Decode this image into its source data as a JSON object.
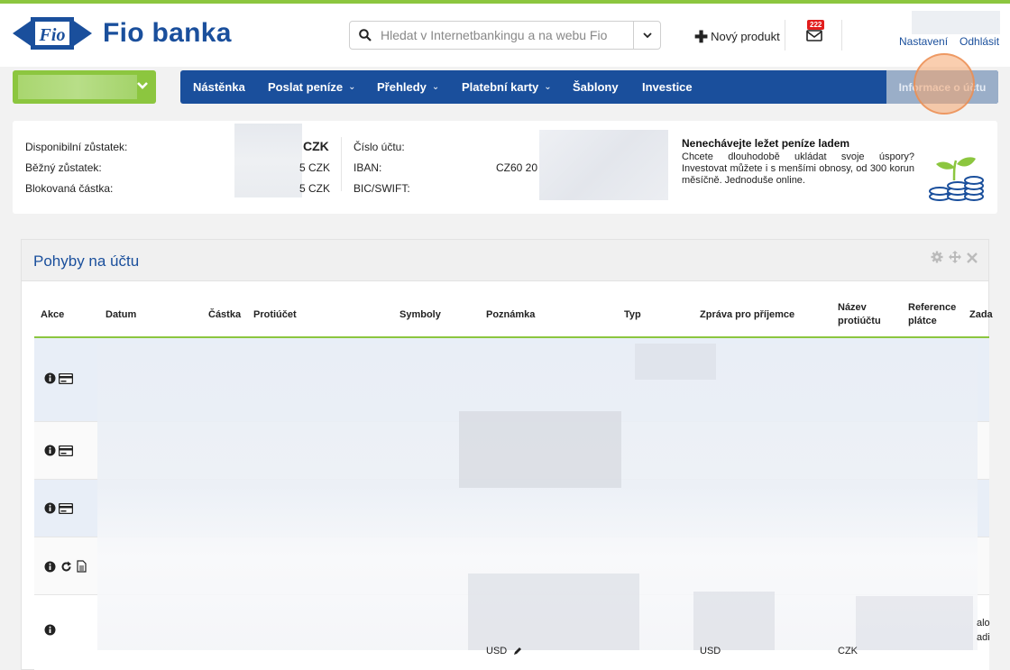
{
  "brand": {
    "name": "Fio banka",
    "logo_mark": "Fio",
    "accent_green": "#8cc63f",
    "brand_blue": "#1a4f9c"
  },
  "header": {
    "search_placeholder": "Hledat v Internetbankingu a na webu Fio",
    "new_product_label": "Nový produkt",
    "messages_count": "222",
    "settings_link": "Nastavení",
    "logout_link": "Odhlásit"
  },
  "nav": {
    "items": [
      {
        "label": "Nástěnka",
        "dropdown": ""
      },
      {
        "label": "Poslat peníze",
        "dropdown": "⌄"
      },
      {
        "label": "Přehledy",
        "dropdown": "⌄"
      },
      {
        "label": "Platební karty",
        "dropdown": "⌄"
      },
      {
        "label": "Šablony",
        "dropdown": ""
      },
      {
        "label": "Investice",
        "dropdown": ""
      }
    ],
    "info_tab": "Informace o účtu"
  },
  "summary": {
    "available_label": "Disponibilní zůstatek:",
    "available_currency": "CZK",
    "current_label": "Běžný zůstatek:",
    "current_value_suffix": "5 CZK",
    "blocked_label": "Blokovaná částka:",
    "blocked_value_suffix": "5 CZK",
    "account_no_label": "Číslo účtu:",
    "iban_label": "IBAN:",
    "iban_value": "CZ60 20",
    "swift_label": "BIC/SWIFT:"
  },
  "promo": {
    "title": "Nenechávejte ležet peníze ladem",
    "text": "Chcete dlouhodobě ukládat svoje úspory? Investovat můžete i s menšími obnosy, od 300 korun měsíčně. Jednoduše online."
  },
  "transactions": {
    "title": "Pohyby na účtu",
    "columns": [
      "Akce",
      "Datum",
      "Částka",
      "Protiúčet",
      "Symboly",
      "Poznámka",
      "Typ",
      "Zpráva pro příjemce",
      "Název protiúčtu",
      "Reference plátce",
      "Zada"
    ],
    "footer_currency_1": "USD",
    "footer_currency_2": "USD",
    "footer_currency_3": "CZK",
    "edge_text_1": "alo",
    "edge_text_2": "adi"
  }
}
